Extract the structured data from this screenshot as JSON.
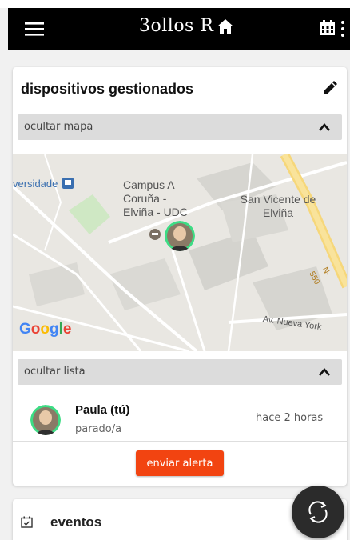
{
  "app": {
    "title": "3ollos R"
  },
  "devices_card": {
    "title": "dispositivos gestionados",
    "map_toggle_label": "ocultar mapa",
    "list_toggle_label": "ocultar lista",
    "alert_button_label": "enviar alerta"
  },
  "map": {
    "place_campus": "Campus A Coruña - Elviña - UDC",
    "place_san_vicente": "San Vicente de Elviña",
    "place_universidade": "versidade",
    "street_nueva_york": "Av. Nueva York",
    "road_n550": "N-550",
    "attribution": "Google",
    "attribution_colors": [
      "#4285F4",
      "#EA4335",
      "#FBBC05",
      "#4285F4",
      "#34A853",
      "#EA4335"
    ]
  },
  "people": [
    {
      "name": "Paula (tú)",
      "status": "parado/a",
      "last_seen": "hace 2 horas"
    }
  ],
  "events_card": {
    "title": "eventos"
  },
  "colors": {
    "appbar": "#000000",
    "accent": "#f24411",
    "fab": "#2b2b2b",
    "avatar_ring": "#3ddc84"
  },
  "icons": [
    "menu-icon",
    "home-icon",
    "calendar-icon",
    "more-vert-icon",
    "pencil-icon",
    "chevron-up-icon",
    "school-icon",
    "bus-stop-icon",
    "refresh-icon"
  ]
}
